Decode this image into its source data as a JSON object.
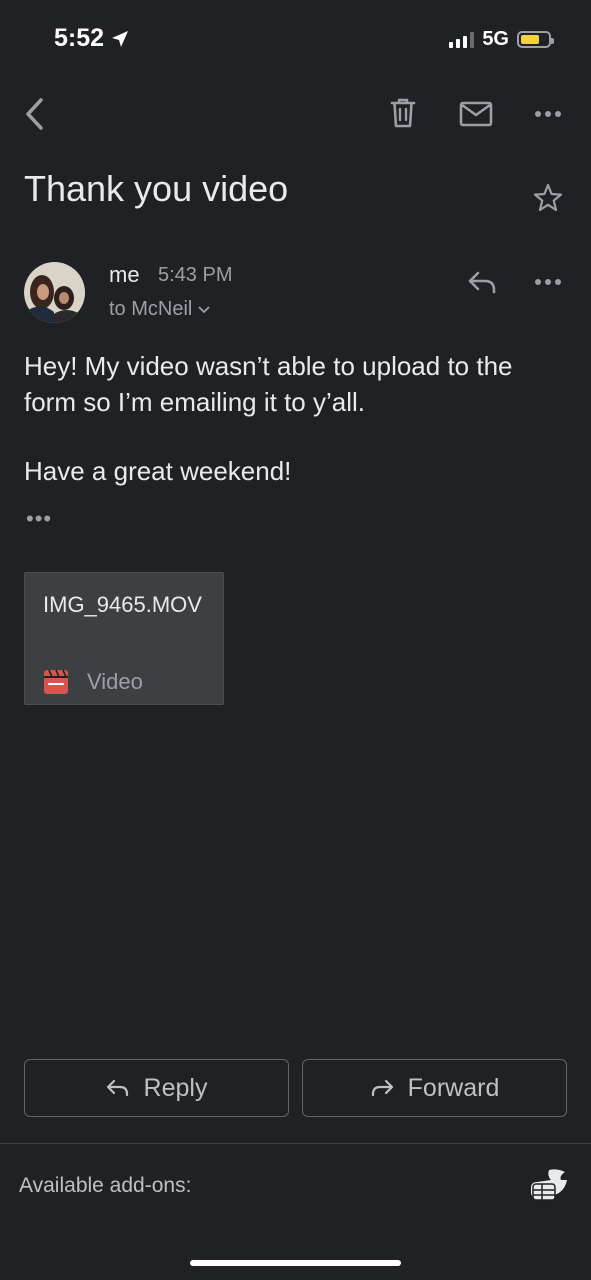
{
  "status_bar": {
    "time": "5:52",
    "network": "5G"
  },
  "email": {
    "subject": "Thank you video",
    "sender": "me",
    "time": "5:43 PM",
    "to": "to McNeil",
    "body": "Hey! My video wasn’t able to upload to the form so I’m emailing it to y’all.",
    "closing": "Have a great weekend!",
    "quoted_indicator": "•••"
  },
  "attachment": {
    "filename": "IMG_9465.MOV",
    "type": "Video"
  },
  "actions": {
    "reply_label": "Reply",
    "forward_label": "Forward"
  },
  "footer": {
    "addons_label": "Available add-ons:"
  },
  "colors": {
    "background": "#202124",
    "video_icon": "#d9534f",
    "battery": "#f4d13d"
  }
}
